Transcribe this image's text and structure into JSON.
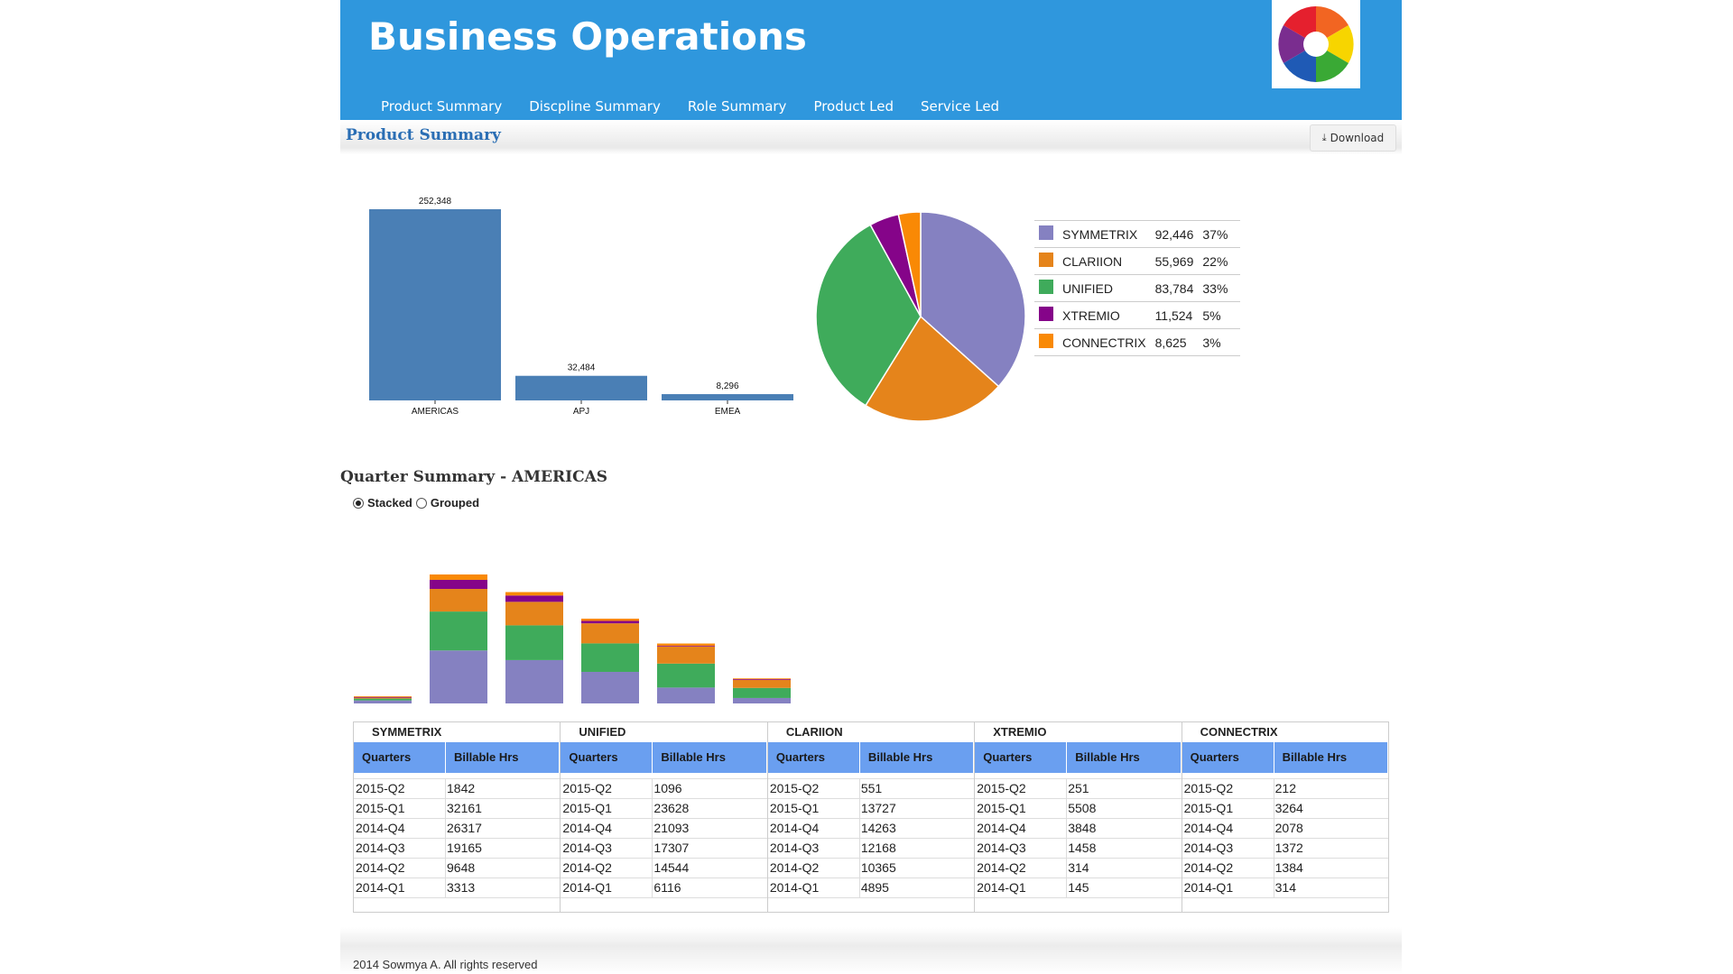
{
  "header": {
    "title": "Business Operations",
    "nav": [
      "Product Summary",
      "Discpline Summary",
      "Role Summary",
      "Product Led",
      "Service Led"
    ]
  },
  "section": {
    "title": "Product Summary",
    "download_label": "Download"
  },
  "colors": {
    "header_bg": "#2f97dd",
    "bar": "#4a7fb5",
    "symmetrix": "#8581c1",
    "clariion": "#e5841b",
    "unified": "#3fab5b",
    "xtremio": "#850489",
    "connectrix": "#f98905"
  },
  "quarter_section": {
    "title": "Quarter Summary - AMERICAS",
    "stacked_label": "Stacked",
    "grouped_label": "Grouped",
    "selected": "Stacked"
  },
  "chart_data": [
    {
      "type": "bar",
      "categories": [
        "AMERICAS",
        "APJ",
        "EMEA"
      ],
      "values": [
        252348,
        32484,
        8296
      ],
      "value_labels": [
        "252,348",
        "32,484",
        "8,296"
      ]
    },
    {
      "type": "pie",
      "labels": [
        "SYMMETRIX",
        "CLARIION",
        "UNIFIED",
        "XTREMIO",
        "CONNECTRIX"
      ],
      "values": [
        92446,
        55969,
        83784,
        11524,
        8625
      ],
      "value_labels": [
        "92,446",
        "55,969",
        "83,784",
        "11,524",
        "8,625"
      ],
      "percents": [
        "37%",
        "22%",
        "33%",
        "5%",
        "3%"
      ]
    },
    {
      "type": "bar",
      "stacked": true,
      "categories": [
        "2015-Q2",
        "2015-Q1",
        "2014-Q4",
        "2014-Q3",
        "2014-Q2",
        "2014-Q1"
      ],
      "series": [
        {
          "name": "SYMMETRIX",
          "values": [
            1842,
            32161,
            26317,
            19165,
            9648,
            3313
          ]
        },
        {
          "name": "UNIFIED",
          "values": [
            1096,
            23628,
            21093,
            17307,
            14544,
            6116
          ]
        },
        {
          "name": "CLARIION",
          "values": [
            551,
            13727,
            14263,
            12168,
            10365,
            4895
          ]
        },
        {
          "name": "XTREMIO",
          "values": [
            251,
            5508,
            3848,
            1458,
            314,
            145
          ]
        },
        {
          "name": "CONNECTRIX",
          "values": [
            212,
            3264,
            2078,
            1372,
            1384,
            314
          ]
        }
      ]
    }
  ],
  "quarter_tables": {
    "col_quarters": "Quarters",
    "col_hours": "Billable Hrs",
    "products": [
      {
        "name": "SYMMETRIX",
        "rows": [
          [
            "2015-Q2",
            "1842"
          ],
          [
            "2015-Q1",
            "32161"
          ],
          [
            "2014-Q4",
            "26317"
          ],
          [
            "2014-Q3",
            "19165"
          ],
          [
            "2014-Q2",
            "9648"
          ],
          [
            "2014-Q1",
            "3313"
          ]
        ]
      },
      {
        "name": "UNIFIED",
        "rows": [
          [
            "2015-Q2",
            "1096"
          ],
          [
            "2015-Q1",
            "23628"
          ],
          [
            "2014-Q4",
            "21093"
          ],
          [
            "2014-Q3",
            "17307"
          ],
          [
            "2014-Q2",
            "14544"
          ],
          [
            "2014-Q1",
            "6116"
          ]
        ]
      },
      {
        "name": "CLARIION",
        "rows": [
          [
            "2015-Q2",
            "551"
          ],
          [
            "2015-Q1",
            "13727"
          ],
          [
            "2014-Q4",
            "14263"
          ],
          [
            "2014-Q3",
            "12168"
          ],
          [
            "2014-Q2",
            "10365"
          ],
          [
            "2014-Q1",
            "4895"
          ]
        ]
      },
      {
        "name": "XTREMIO",
        "rows": [
          [
            "2015-Q2",
            "251"
          ],
          [
            "2015-Q1",
            "5508"
          ],
          [
            "2014-Q4",
            "3848"
          ],
          [
            "2014-Q3",
            "1458"
          ],
          [
            "2014-Q2",
            "314"
          ],
          [
            "2014-Q1",
            "145"
          ]
        ]
      },
      {
        "name": "CONNECTRIX",
        "rows": [
          [
            "2015-Q2",
            "212"
          ],
          [
            "2015-Q1",
            "3264"
          ],
          [
            "2014-Q4",
            "2078"
          ],
          [
            "2014-Q3",
            "1372"
          ],
          [
            "2014-Q2",
            "1384"
          ],
          [
            "2014-Q1",
            "314"
          ]
        ]
      }
    ]
  },
  "footer": {
    "text": "2014 Sowmya A. All rights reserved"
  }
}
